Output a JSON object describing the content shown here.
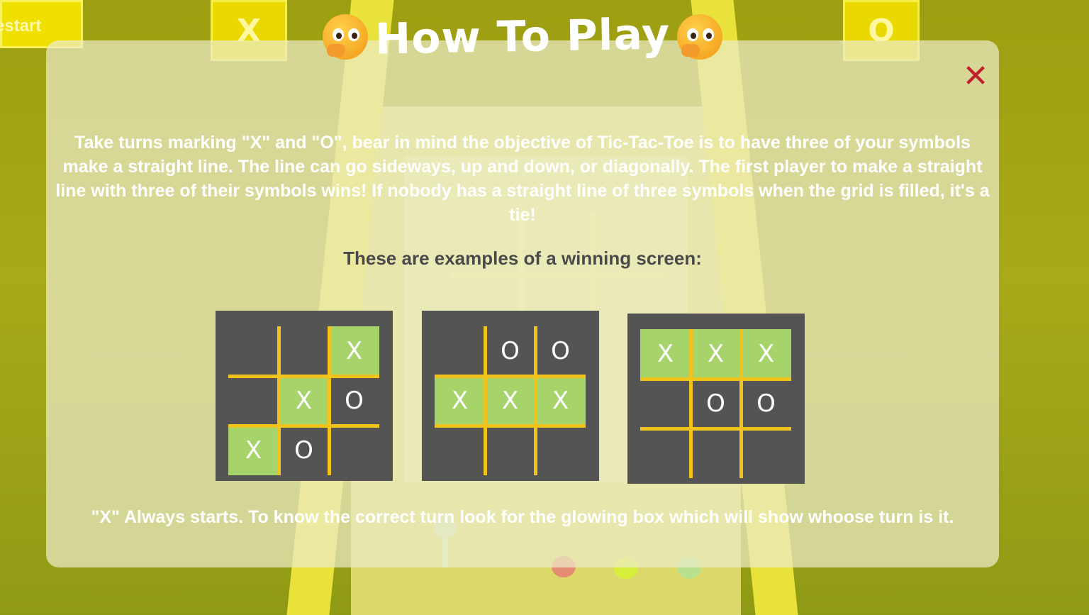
{
  "header": {
    "restart_label": "estart",
    "player_x_symbol": "X",
    "player_o_symbol": "O"
  },
  "modal": {
    "title": "How To Play",
    "close_label": "✕",
    "description": "Take turns marking \"X\" and \"O\", bear in mind the objective of Tic-Tac-Toe is to have three of your symbols make a straight line. The line can go sideways, up and down, or diagonally. The first player to make a straight line with three of their symbols wins! If nobody has a straight line of three symbols when the grid is filled, it's a tie!",
    "examples_heading": "These are examples of a winning screen:",
    "footer_note": "\"X\" Always starts. To know the correct turn look for the glowing box which will show whoose turn is it."
  },
  "examples": [
    {
      "cells": [
        "",
        "",
        "X",
        "",
        "X",
        "O",
        "X",
        "O",
        ""
      ],
      "winning": [
        2,
        4,
        6
      ]
    },
    {
      "cells": [
        "",
        "O",
        "O",
        "X",
        "X",
        "X",
        "",
        "",
        ""
      ],
      "winning": [
        3,
        4,
        5
      ]
    },
    {
      "cells": [
        "X",
        "X",
        "X",
        "",
        "O",
        "O",
        "",
        "",
        ""
      ],
      "winning": [
        0,
        1,
        2
      ]
    }
  ],
  "colors": {
    "win_cell": "#a6d46a",
    "board_bg": "#545454",
    "grid_line": "#f0c419",
    "close_icon": "#c0202a"
  }
}
